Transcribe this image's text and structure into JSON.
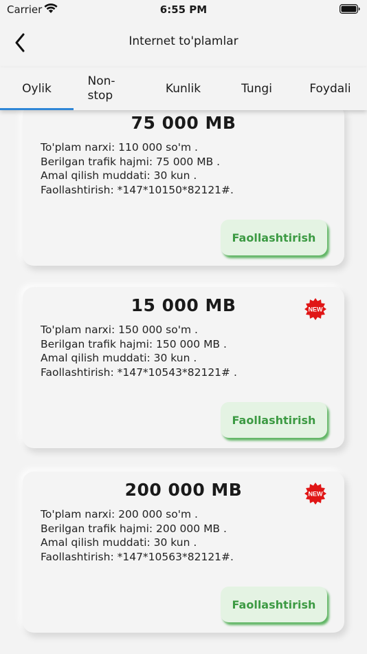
{
  "status_bar": {
    "carrier": "Carrier",
    "time": "6:55 PM"
  },
  "nav": {
    "title": "Internet to'plamlar"
  },
  "tabs": [
    {
      "label": "Oylik",
      "active": true
    },
    {
      "label": "Non-\nstop",
      "active": false
    },
    {
      "label": "Kunlik",
      "active": false
    },
    {
      "label": "Tungi",
      "active": false
    },
    {
      "label": "Foydali",
      "active": false
    }
  ],
  "colors": {
    "accent": "#2f86d6",
    "button_text": "#3c9a43",
    "button_bg": "#e4f3e3",
    "badge": "#e01616"
  },
  "packages": [
    {
      "title": "75 000 MB",
      "price": "To'plam narxi: 110 000 so'm .",
      "traffic": "Berilgan trafik hajmi: 75 000 MB .",
      "duration": "Amal qilish muddati: 30 kun .",
      "activation": "Faollashtirish: *147*10150*82121#.",
      "button_label": "Faollashtirish",
      "is_new": false
    },
    {
      "title": "15 000 MB",
      "price": "To'plam narxi: 150 000 so'm .",
      "traffic": "Berilgan trafik hajmi: 150 000 MB .",
      "duration": "Amal qilish muddati: 30 kun .",
      "activation": "Faollashtirish: *147*10543*82121# .",
      "button_label": "Faollashtirish",
      "is_new": true,
      "badge_label": "NEW"
    },
    {
      "title": "200 000 MB",
      "price": "To'plam narxi: 200 000 so'm .",
      "traffic": "Berilgan trafik hajmi: 200 000 MB .",
      "duration": "Amal qilish muddati: 30 kun .",
      "activation": "Faollashtirish: *147*10563*82121#.",
      "button_label": "Faollashtirish",
      "is_new": true,
      "badge_label": "NEW"
    }
  ]
}
